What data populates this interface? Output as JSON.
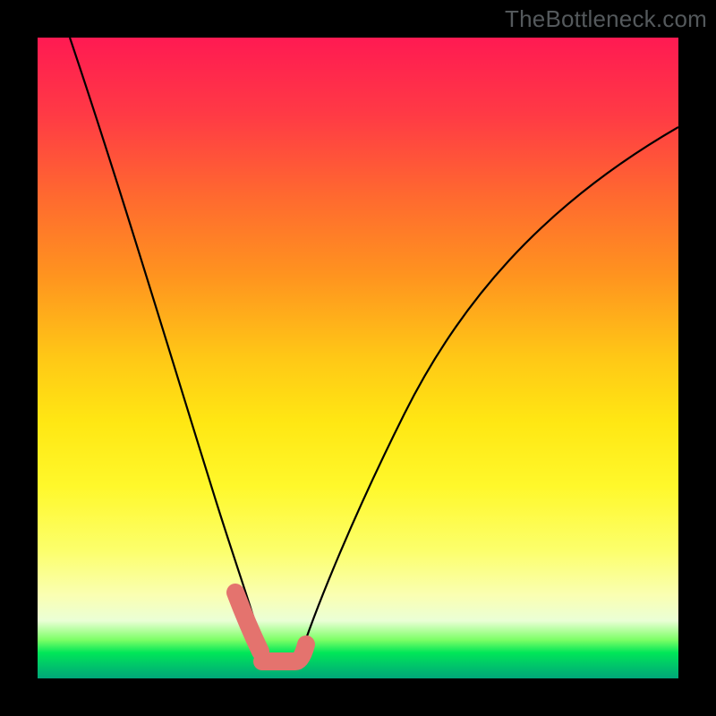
{
  "watermark": "TheBottleneck.com",
  "chart_data": {
    "type": "line",
    "title": "",
    "xlabel": "",
    "ylabel": "",
    "xlim": [
      0,
      100
    ],
    "ylim": [
      0,
      100
    ],
    "series": [
      {
        "name": "left-curve",
        "x": [
          5,
          7.5,
          10,
          12.5,
          15,
          17.5,
          20,
          22.5,
          25,
          27.5,
          30,
          31,
          32,
          33,
          34,
          35
        ],
        "y": [
          100,
          90,
          80,
          70,
          60,
          51,
          42,
          34,
          26,
          19,
          12,
          9.5,
          7,
          5,
          3.5,
          2.5
        ]
      },
      {
        "name": "right-curve",
        "x": [
          40,
          42,
          45,
          50,
          55,
          60,
          65,
          70,
          75,
          80,
          85,
          90,
          95,
          100
        ],
        "y": [
          2.5,
          5,
          10,
          20,
          30,
          39,
          47,
          54,
          60,
          66,
          71,
          76,
          80.5,
          85
        ]
      },
      {
        "name": "pink-markers-left",
        "x": [
          30.5,
          31.2,
          32.0,
          32.8,
          33.6,
          34.3,
          35.0
        ],
        "y": [
          11,
          9.5,
          8,
          6.6,
          5.3,
          4.2,
          3.2
        ]
      },
      {
        "name": "pink-valley",
        "x": [
          35,
          36,
          37,
          38,
          39,
          40,
          41,
          42
        ],
        "y": [
          2.8,
          2.5,
          2.3,
          2.2,
          2.2,
          2.5,
          3.5,
          5
        ]
      }
    ],
    "background_gradient": {
      "top": "#ff1a52",
      "mid": "#fff82b",
      "bottom": "#00a679"
    }
  }
}
